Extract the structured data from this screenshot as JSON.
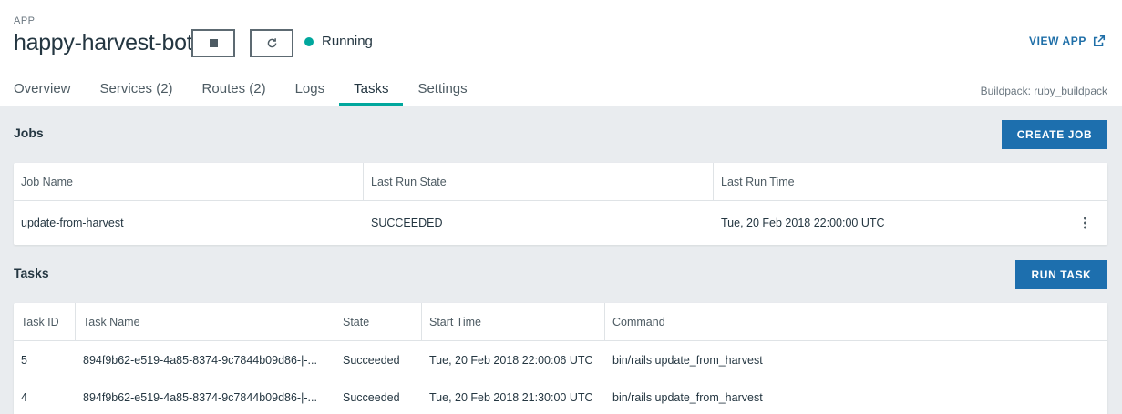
{
  "app": {
    "kicker": "APP",
    "name": "happy-harvest-bot",
    "status": "Running",
    "view_app": "VIEW APP",
    "buildpack": "Buildpack: ruby_buildpack"
  },
  "tabs": [
    {
      "label": "Overview"
    },
    {
      "label": "Services (2)"
    },
    {
      "label": "Routes (2)"
    },
    {
      "label": "Logs"
    },
    {
      "label": "Tasks",
      "active": true
    },
    {
      "label": "Settings"
    }
  ],
  "jobs": {
    "title": "Jobs",
    "create_label": "CREATE JOB",
    "columns": [
      "Job Name",
      "Last Run State",
      "Last Run Time"
    ],
    "rows": [
      {
        "name": "update-from-harvest",
        "state": "SUCCEEDED",
        "time": "Tue, 20 Feb 2018 22:00:00 UTC"
      }
    ]
  },
  "tasks": {
    "title": "Tasks",
    "run_label": "RUN TASK",
    "columns": [
      "Task ID",
      "Task Name",
      "State",
      "Start Time",
      "Command"
    ],
    "rows": [
      {
        "id": "5",
        "name": "894f9b62-e519-4a85-8374-9c7844b09d86-|-...",
        "state": "Succeeded",
        "start": "Tue, 20 Feb 2018 22:00:06 UTC",
        "command": "bin/rails update_from_harvest"
      },
      {
        "id": "4",
        "name": "894f9b62-e519-4a85-8374-9c7844b09d86-|-...",
        "state": "Succeeded",
        "start": "Tue, 20 Feb 2018 21:30:00 UTC",
        "command": "bin/rails update_from_harvest"
      }
    ]
  },
  "colors": {
    "accent": "#00a79d",
    "primary_button": "#1d6fae",
    "link": "#1f6fa8",
    "content_bg": "#e9ecef"
  },
  "icons": {
    "stop": "stop-icon",
    "restart": "restart-icon",
    "external": "external-link-icon",
    "row_menu": "kebab-menu-icon"
  }
}
